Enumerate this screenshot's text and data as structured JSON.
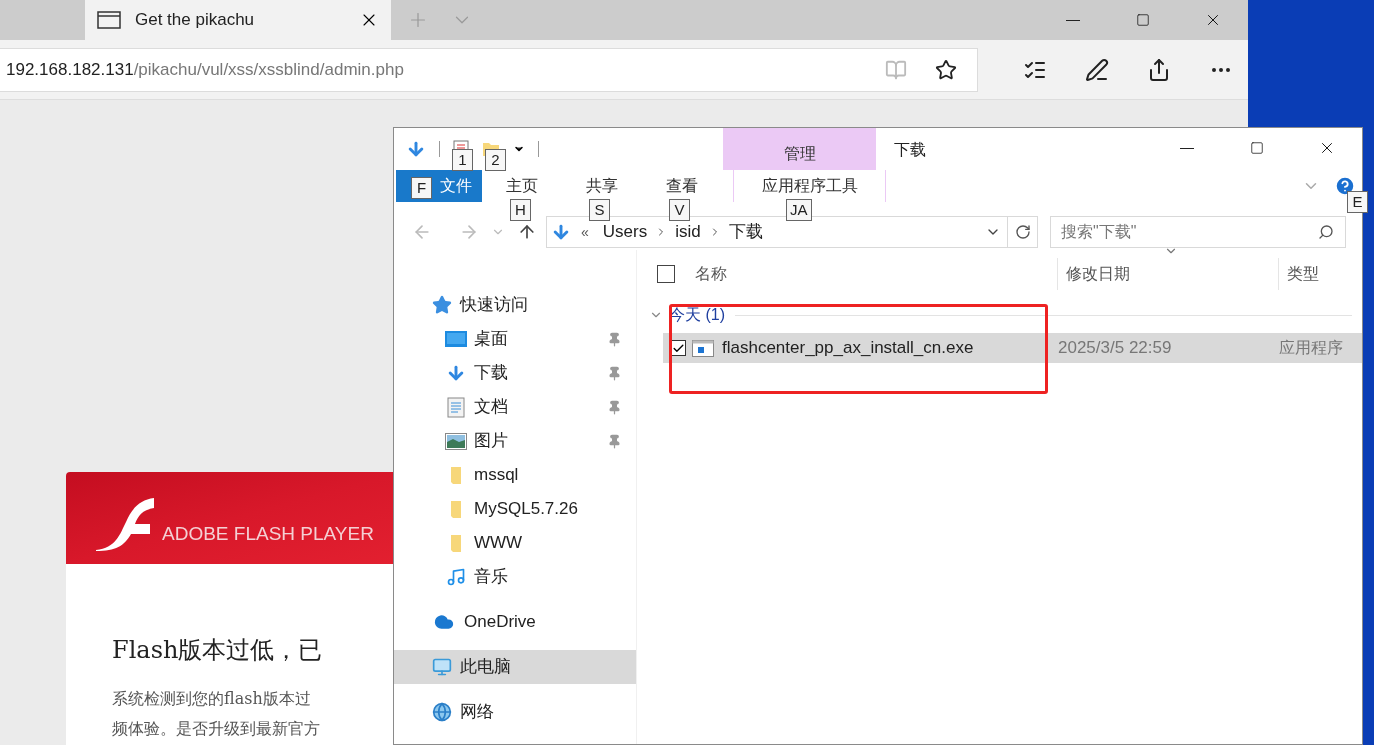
{
  "browser": {
    "tabs": [
      {
        "title": "Get the pikachu",
        "selected": true
      }
    ],
    "address": {
      "host": "192.168.182.131",
      "path": "/pikachu/vul/xss/xssblind/admin.php"
    }
  },
  "page": {
    "banner_text": "ADOBE FLASH PLAYER",
    "heading": "Flash版本过低，已",
    "paragraph_lines": [
      "系统检测到您的flash版本过",
      "频体验。是否升级到最新官方"
    ]
  },
  "explorer": {
    "title": "下载",
    "context_group": "管理",
    "ribbon_tabs": [
      {
        "label": "文件",
        "kind": "file"
      },
      {
        "label": "主页",
        "kind": "tab"
      },
      {
        "label": "共享",
        "kind": "tab"
      },
      {
        "label": "查看",
        "kind": "tab"
      },
      {
        "label": "应用程序工具",
        "kind": "context"
      }
    ],
    "keytips": [
      "1",
      "2",
      "F",
      "H",
      "S",
      "V",
      "JA",
      "E"
    ],
    "breadcrumb_overflow": "«",
    "breadcrumb": [
      "Users",
      "isid",
      "下载"
    ],
    "search": {
      "placeholder": "搜索\"下载\""
    },
    "nav": [
      {
        "label": "快速访问",
        "kind": "quick",
        "selected": false,
        "children": [
          {
            "label": "桌面",
            "kind": "desktop",
            "pinned": true
          },
          {
            "label": "下载",
            "kind": "downloads",
            "pinned": true
          },
          {
            "label": "文档",
            "kind": "documents",
            "pinned": true
          },
          {
            "label": "图片",
            "kind": "pictures",
            "pinned": true
          },
          {
            "label": "mssql",
            "kind": "folder",
            "pinned": false
          },
          {
            "label": "MySQL5.7.26",
            "kind": "folder",
            "pinned": false
          },
          {
            "label": "WWW",
            "kind": "folder",
            "pinned": false
          },
          {
            "label": "音乐",
            "kind": "music",
            "pinned": false
          }
        ]
      },
      {
        "label": "OneDrive",
        "kind": "onedrive",
        "selected": false
      },
      {
        "label": "此电脑",
        "kind": "pc",
        "selected": true
      },
      {
        "label": "网络",
        "kind": "network",
        "selected": false
      }
    ],
    "columns": [
      "名称",
      "修改日期",
      "类型"
    ],
    "select_all_checked": false,
    "groups": [
      {
        "label": "今天 (1)",
        "expanded": true,
        "files": [
          {
            "name": "flashcenter_pp_ax_install_cn.exe",
            "date": "2025/3/5 22:59",
            "type": "应用程序",
            "selected": true,
            "checked": true
          }
        ]
      }
    ]
  }
}
